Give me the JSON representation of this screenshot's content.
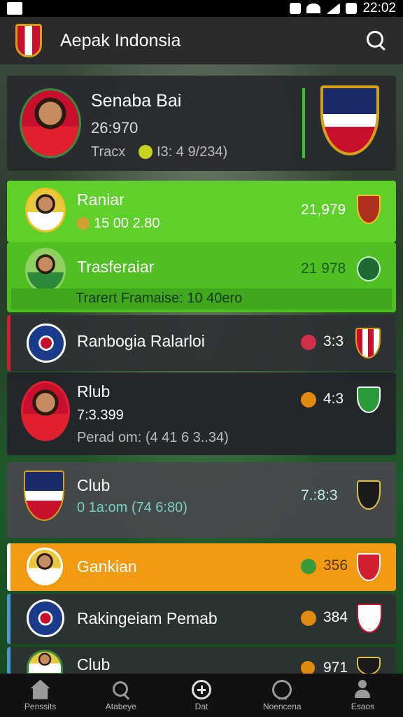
{
  "status_bar": {
    "time": "22:02"
  },
  "app_bar": {
    "title": "Aepak Indonsia"
  },
  "featured": {
    "name": "Senaba Bai",
    "score": "26:970",
    "detail_prefix": "Tracx",
    "detail": "I3: 4 9/234)"
  },
  "rows": [
    {
      "name": "Raniar",
      "sub": "15 00 2.80",
      "score": "21,979"
    },
    {
      "name": "Trasferaiar",
      "sub": "",
      "score": "21 978",
      "banner": "Trarert Framaise: 10 40ero"
    },
    {
      "name": "Ranbogia Ralarloi",
      "sub": "",
      "score": "3:3"
    },
    {
      "name": "Rlub",
      "sub": "7:3.399",
      "score": "4:3",
      "extra": "Perad om: (4 41 6 3..34)"
    },
    {
      "name": "Club",
      "sub": "0 1a:om (74 6:80)",
      "score": "7.:8:3"
    },
    {
      "name": "Gankian",
      "sub": "",
      "score": "356"
    },
    {
      "name": "Rakingeiam Pemab",
      "sub": "",
      "score": "384"
    },
    {
      "name": "Club",
      "sub": "",
      "score": "971"
    }
  ],
  "bottom_nav": [
    {
      "label": "Penssits",
      "icon": "home-icon"
    },
    {
      "label": "Atabeye",
      "icon": "search-icon"
    },
    {
      "label": "Dat",
      "icon": "plus-circle-icon"
    },
    {
      "label": "Noencena",
      "icon": "news-icon"
    },
    {
      "label": "Esaos",
      "icon": "profile-icon"
    }
  ],
  "colors": {
    "green_highlight": "#5fcf2a",
    "orange_highlight": "#f29a12",
    "card": "#2d3034",
    "accent_green": "#3fbf2f"
  }
}
